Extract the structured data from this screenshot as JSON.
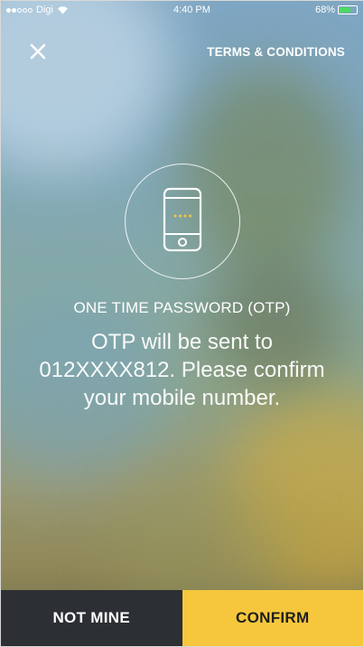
{
  "status_bar": {
    "carrier": "Digi",
    "time": "4:40 PM",
    "battery": "68%",
    "battery_level": 0.68,
    "signal_filled": 2,
    "signal_total": 5
  },
  "header": {
    "close_icon": "close-icon",
    "terms_label": "TERMS & CONDITIONS"
  },
  "otp": {
    "icon": "mobile-phone-icon",
    "title": "ONE TIME PASSWORD (OTP)",
    "message": "OTP will be sent to 012XXXX812. Please confirm your mobile number."
  },
  "actions": {
    "not_mine_label": "NOT MINE",
    "confirm_label": "CONFIRM"
  },
  "colors": {
    "confirm_bg": "#f6c73d",
    "not_mine_bg": "#2c2f33",
    "battery_green": "#4cd964"
  }
}
